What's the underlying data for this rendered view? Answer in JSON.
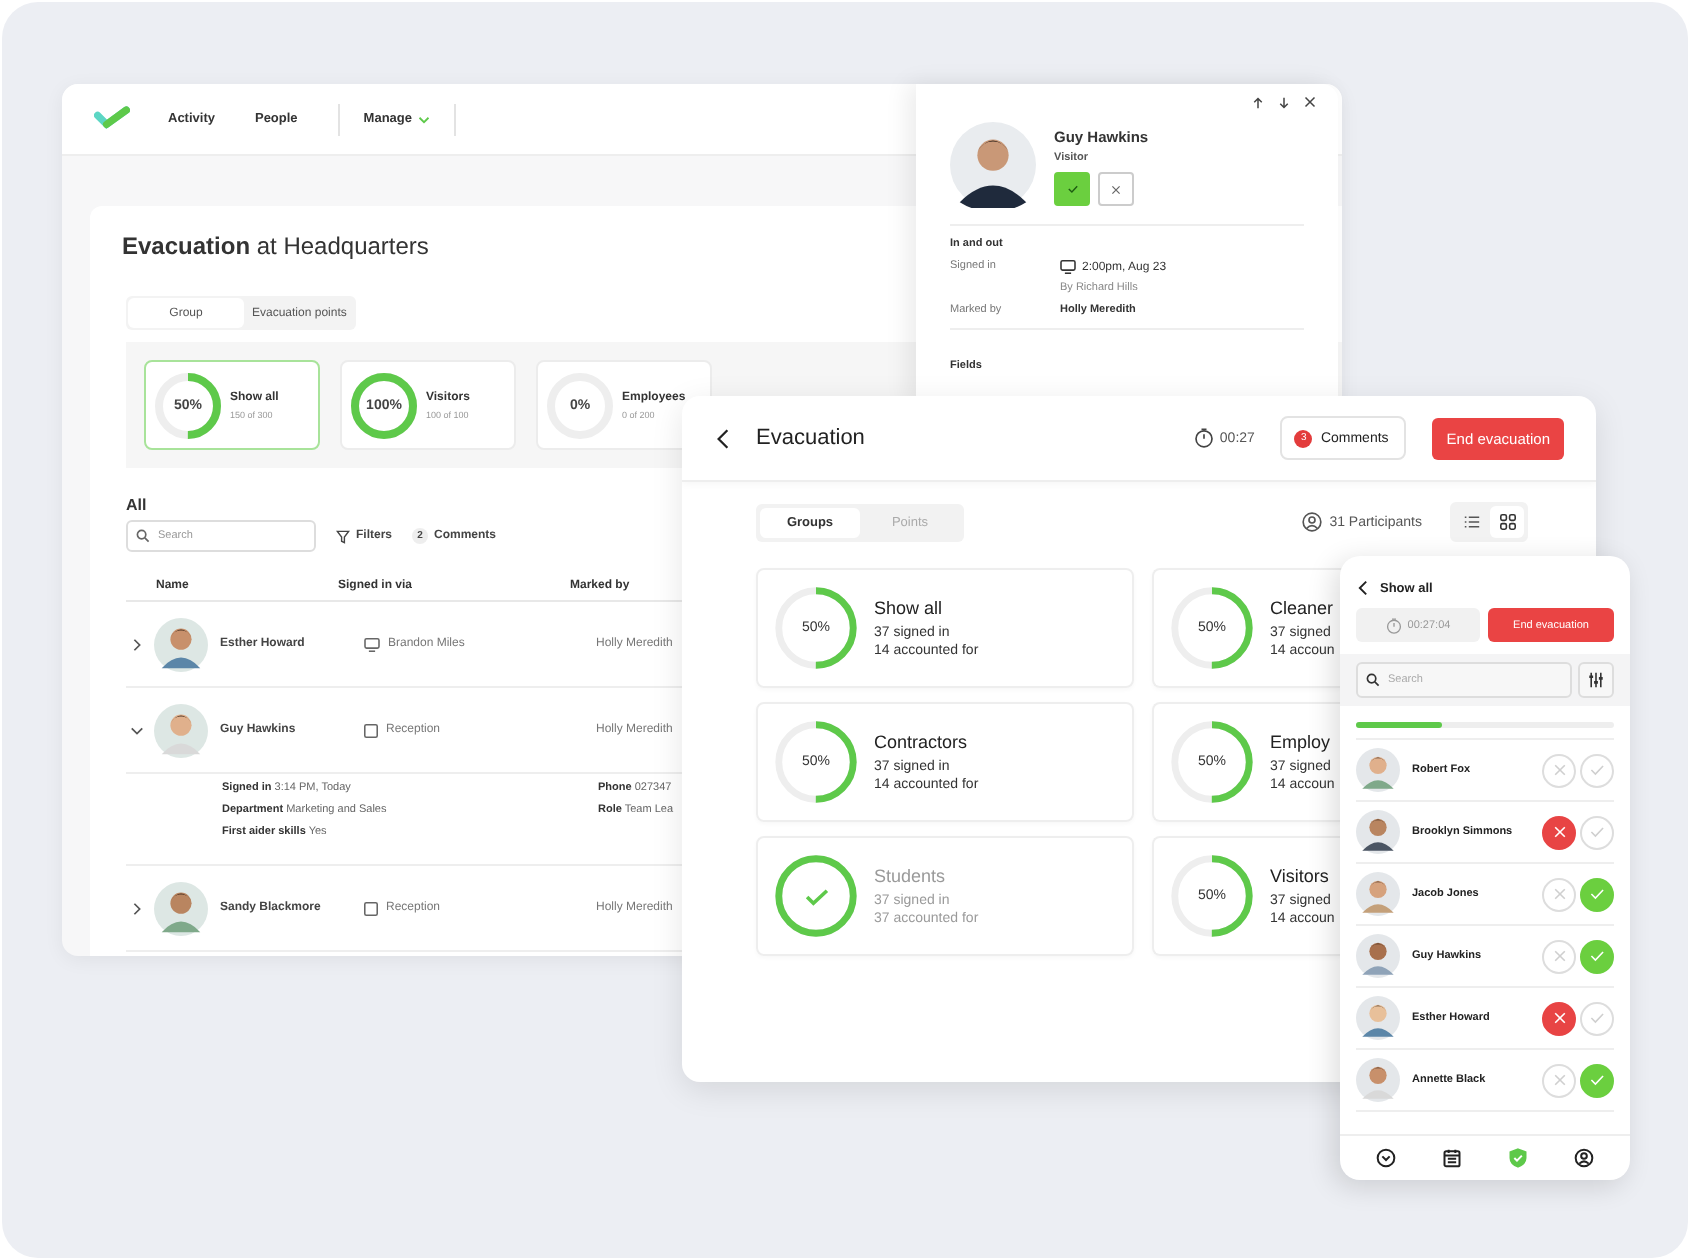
{
  "main_window": {
    "nav": [
      {
        "label": "Activity",
        "kind": "link"
      },
      {
        "label": "People",
        "kind": "link"
      },
      {
        "label": "Manage",
        "kind": "menu"
      }
    ],
    "title": "**Evacuation** at Headquarters",
    "tabs": [
      {
        "label": "Group",
        "selected": true
      },
      {
        "label": "Evacuation points",
        "selected": false
      }
    ],
    "stats": [
      {
        "percent": "50%",
        "level": 0.5,
        "label": "Show all",
        "count": "150 of 300",
        "selected": true
      },
      {
        "percent": "100%",
        "level": 1,
        "label": "Visitors",
        "count": "100 of 100",
        "selected": false
      },
      {
        "percent": "0%",
        "level": 0,
        "label": "Employees",
        "count": "0 of 200",
        "selected": false
      }
    ],
    "list_title": "All",
    "search": {
      "placeholder": "Search"
    },
    "filters": "Filters",
    "comments": {
      "count": "2",
      "label": "Comments"
    },
    "columns": [
      "Name",
      "Signed in via",
      "Marked by"
    ],
    "rows": [
      {
        "name": "Esther Howard",
        "signed_in_via": "Brandon Miles",
        "kind": "desk",
        "marked_by": "Holly Meredith",
        "expanded": false
      },
      {
        "name": "Guy Hawkins",
        "signed_in_via": "Reception",
        "kind": "kiosk",
        "marked_by": "Holly Meredith",
        "expanded": true,
        "details": [
          "**Signed in** 3:14 PM, Today",
          "**Department** Marketing and Sales",
          "**First aider skills** Yes"
        ],
        "details_right": [
          "**Phone** 027347",
          "**Role** Team Lea"
        ]
      },
      {
        "name": "Sandy Blackmore",
        "signed_in_via": "Reception",
        "kind": "kiosk",
        "marked_by": "Holly Meredith",
        "expanded": false
      }
    ]
  },
  "detail_panel": {
    "name": "Guy Hawkins",
    "role": "Visitor",
    "actions": [
      {
        "kind": "check",
        "selected": true
      },
      {
        "kind": "cross",
        "selected": false
      }
    ],
    "section": "In and out",
    "fields": [
      {
        "label": "Signed in",
        "value": "2:00pm, Aug 23",
        "sub": "By Richard Hills",
        "kind": "desk"
      },
      {
        "label": "Marked by",
        "value": "Holly Meredith",
        "kind": "person"
      }
    ],
    "next_section": "Fields"
  },
  "evacuation_window": {
    "title": "Evacuation",
    "timer": "00:27",
    "comments": {
      "count": "3",
      "label": "Comments"
    },
    "end_button": "End evacuation",
    "tabs": [
      {
        "label": "Groups",
        "selected": true
      },
      {
        "label": "Points",
        "selected": false
      }
    ],
    "participants": "31 Participants",
    "views": [
      {
        "kind": "list",
        "selected": false
      },
      {
        "kind": "grid",
        "selected": true
      }
    ],
    "groups": [
      {
        "name": "Show all",
        "signed_in": "37 signed in",
        "accounted": "14 accounted for",
        "percent": "50%",
        "level": 0.5,
        "complete": false
      },
      {
        "name": "Cleaner",
        "signed_in": "37 signed",
        "accounted": "14 accoun",
        "percent": "50%",
        "level": 0.5,
        "complete": false
      },
      {
        "name": "Contractors",
        "signed_in": "37 signed in",
        "accounted": "14 accounted for",
        "percent": "50%",
        "level": 0.5,
        "complete": false
      },
      {
        "name": "Employ",
        "signed_in": "37 signed",
        "accounted": "14 accoun",
        "percent": "50%",
        "level": 0.5,
        "complete": false
      },
      {
        "name": "Students",
        "signed_in": "37 signed in",
        "accounted": "37 accounted for",
        "level": 1,
        "complete": true
      },
      {
        "name": "Visitors",
        "signed_in": "37 signed",
        "accounted": "14 accoun",
        "percent": "50%",
        "level": 0.5,
        "complete": false
      }
    ]
  },
  "phone": {
    "title": "Show all",
    "timer": "00:27:04",
    "end_button": "End evacuation",
    "search": {
      "placeholder": "Search"
    },
    "progress": {
      "level": 0.33
    },
    "people": [
      {
        "name": "Robert Fox",
        "absent": false,
        "present": false
      },
      {
        "name": "Brooklyn Simmons",
        "absent": true,
        "present": false
      },
      {
        "name": "Jacob Jones",
        "absent": false,
        "present": true
      },
      {
        "name": "Guy Hawkins",
        "absent": false,
        "present": true
      },
      {
        "name": "Esther Howard",
        "absent": true,
        "present": false
      },
      {
        "name": "Annette Black",
        "absent": false,
        "present": true
      }
    ],
    "nav": [
      {
        "kind": "down",
        "selected": false
      },
      {
        "kind": "calendar",
        "selected": false
      },
      {
        "kind": "shield",
        "selected": true
      },
      {
        "kind": "user",
        "selected": false
      }
    ]
  }
}
